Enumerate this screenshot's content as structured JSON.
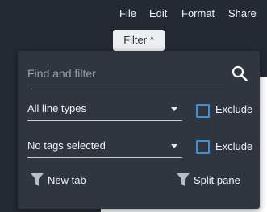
{
  "menu": {
    "file": "File",
    "edit": "Edit",
    "format": "Format",
    "share": "Share"
  },
  "filter_button": {
    "label": "Filter",
    "caret": "^"
  },
  "panel": {
    "search": {
      "placeholder": "Find and filter",
      "value": ""
    },
    "line_types": {
      "value": "All line types"
    },
    "tags": {
      "value": "No tags selected"
    },
    "exclude_1": {
      "label": "Exclude",
      "checked": false
    },
    "exclude_2": {
      "label": "Exclude",
      "checked": false
    },
    "new_tab": {
      "label": "New tab"
    },
    "split_pane": {
      "label": "Split pane"
    }
  },
  "colors": {
    "background": "#232a33",
    "panel": "#2f3640",
    "accent": "#3d8fd6"
  }
}
